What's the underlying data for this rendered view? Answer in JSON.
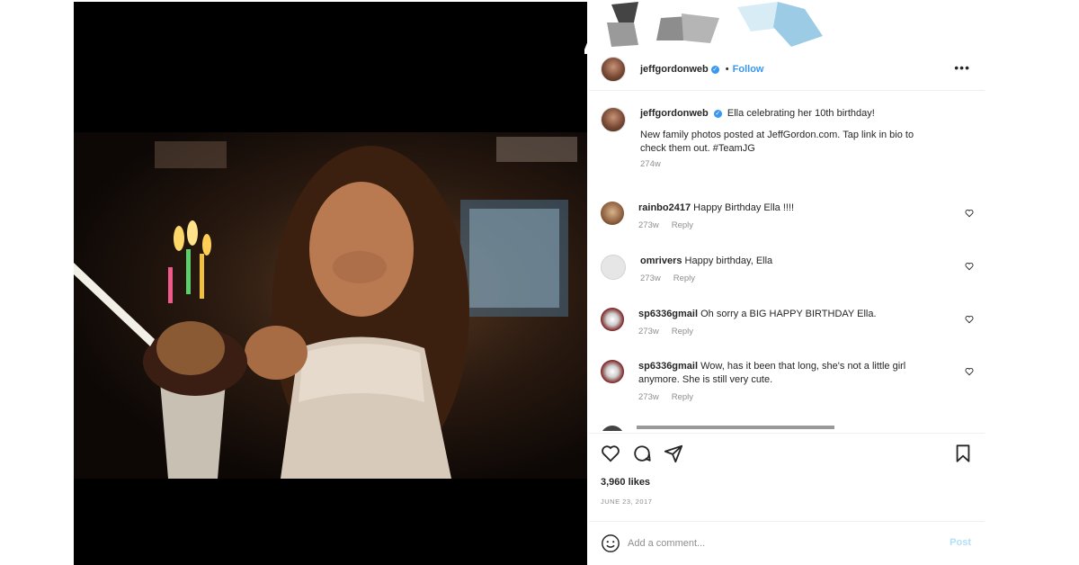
{
  "post": {
    "username": "jeffgordonweb",
    "follow_label": "Follow",
    "more_icon": "more-horizontal-icon",
    "caption_line1": "Ella celebrating her 10th birthday!",
    "caption_line2": "New family photos posted at JeffGordon.com. Tap link in bio to",
    "caption_line3": "check them out. #TeamJG",
    "caption_age": "274w",
    "likes": "3,960 likes",
    "date": "JUNE 23, 2017",
    "comment_placeholder": "Add a comment...",
    "post_label": "Post"
  },
  "comments": [
    {
      "user": "rainbo2417",
      "text": "Happy Birthday Ella !!!!",
      "age": "273w",
      "reply": "Reply"
    },
    {
      "user": "omrivers",
      "text": "Happy birthday, Ella",
      "age": "273w",
      "reply": "Reply"
    },
    {
      "user": "sp6336gmail",
      "text": "Oh sorry a BIG HAPPY BIRTHDAY Ella.",
      "age": "273w",
      "reply": "Reply"
    },
    {
      "user": "sp6336gmail",
      "text1": "Wow, has it been that long, she's not a little girl",
      "text2": "anymore. She is still very cute.",
      "age": "273w",
      "reply": "Reply"
    }
  ],
  "colors": {
    "accent": "#3897f0",
    "post_disabled": "#b2dffc",
    "meta": "#8e8e8e"
  }
}
